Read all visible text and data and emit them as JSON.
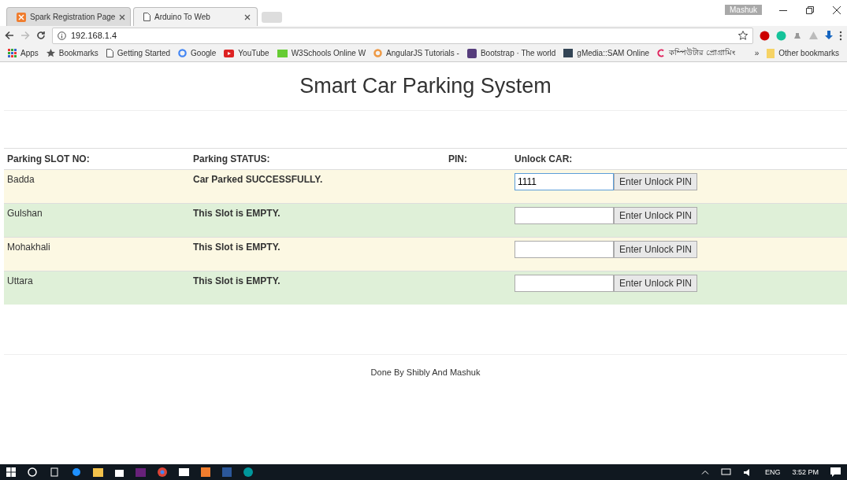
{
  "browser": {
    "tabs": [
      {
        "title": "Spark Registration Page",
        "selected": false,
        "kind": "xampp"
      },
      {
        "title": "Arduino To Web",
        "selected": true,
        "kind": "page"
      }
    ],
    "profile": "Mashuk",
    "address": "192.168.1.4",
    "bookmarks": [
      {
        "label": "Apps",
        "kind": "apps"
      },
      {
        "label": "Bookmarks",
        "kind": "star"
      },
      {
        "label": "Getting Started",
        "kind": "page"
      },
      {
        "label": "Google",
        "kind": "google"
      },
      {
        "label": "YouTube",
        "kind": "youtube"
      },
      {
        "label": "W3Schools Online W",
        "kind": "w3"
      },
      {
        "label": "AngularJS Tutorials -",
        "kind": "angular"
      },
      {
        "label": "Bootstrap · The world",
        "kind": "bootstrap"
      },
      {
        "label": "gMedia::SAM Online",
        "kind": "gmedia"
      },
      {
        "label": "কম্পিউটার প্রোগ্রামিং",
        "kind": "c"
      }
    ],
    "overflow": "»",
    "other_bookmarks": "Other bookmarks"
  },
  "page": {
    "title": "Smart Car Parking System",
    "columns": [
      "Parking SLOT NO:",
      "Parking STATUS:",
      "PIN:",
      "Unlock CAR:"
    ],
    "rows": [
      {
        "slot": "Badda",
        "status": "Car Parked SUCCESSFULLY.",
        "pin_value": "1111",
        "focused": true,
        "button": "Enter Unlock PIN",
        "color": "#fcf8e3"
      },
      {
        "slot": "Gulshan",
        "status": "This Slot is EMPTY.",
        "focused": false,
        "button": "Enter Unlock PIN",
        "color": "#dff0d8"
      },
      {
        "slot": "Mohakhali",
        "status": "This Slot is EMPTY.",
        "focused": false,
        "button": "Enter Unlock PIN",
        "color": "#fcf8e3"
      },
      {
        "slot": "Uttara",
        "status": "This Slot is EMPTY.",
        "focused": false,
        "button": "Enter Unlock PIN",
        "color": "#dff0d8"
      }
    ],
    "footer": "Done By Shibly And Mashuk"
  },
  "taskbar": {
    "language": "ENG",
    "time": "3:52 PM"
  }
}
